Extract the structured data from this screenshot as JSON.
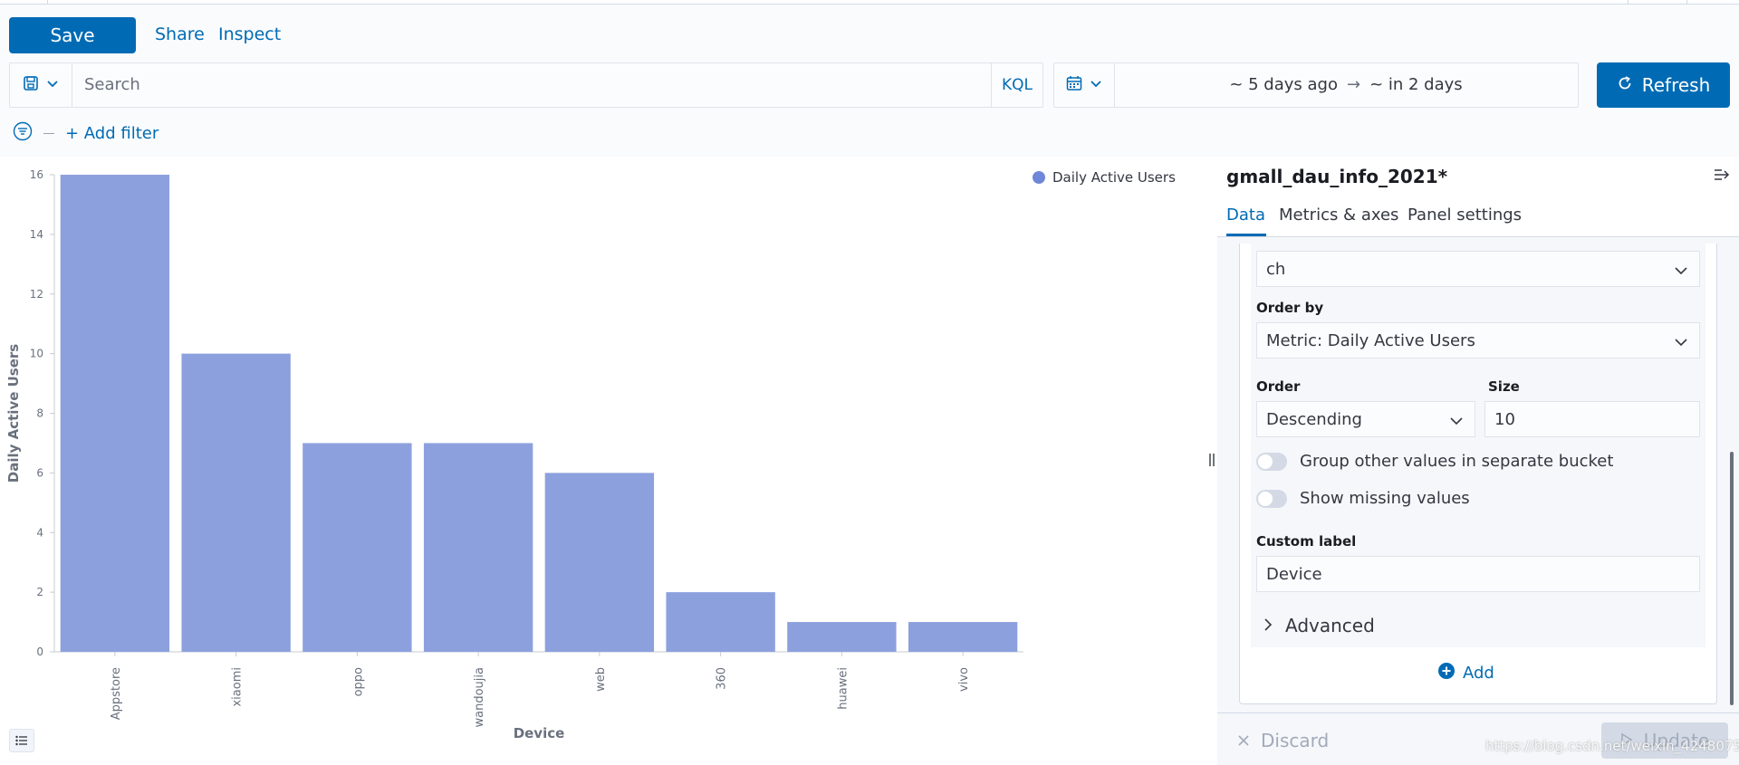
{
  "toolbar": {
    "save_label": "Save",
    "share_label": "Share",
    "inspect_label": "Inspect"
  },
  "query": {
    "search_placeholder": "Search",
    "language": "KQL"
  },
  "time": {
    "start": "~ 5 days ago",
    "arrow": "→",
    "end": "~ in 2 days"
  },
  "refresh_label": "Refresh",
  "filters": {
    "add_label": "+ Add filter"
  },
  "chart_data": {
    "type": "bar",
    "categories": [
      "Appstore",
      "xiaomi",
      "oppo",
      "wandoujia",
      "web",
      "360",
      "huawei",
      "vivo"
    ],
    "series": [
      {
        "name": "Daily Active Users",
        "values": [
          16,
          10,
          7,
          7,
          6,
          2,
          1,
          1
        ],
        "color": "#8da0de"
      }
    ],
    "xlabel": "Device",
    "ylabel": "Daily Active Users",
    "ylim": [
      0,
      16
    ],
    "yticks": [
      0,
      2,
      4,
      6,
      8,
      10,
      12,
      14,
      16
    ],
    "legend_position": "top-right",
    "grid": false
  },
  "panel": {
    "title": "gmall_dau_info_2021*",
    "tabs": [
      "Data",
      "Metrics & axes",
      "Panel settings"
    ],
    "active_tab": "Data",
    "field_value": "ch",
    "order_by_label": "Order by",
    "order_by_value": "Metric: Daily Active Users",
    "order_label": "Order",
    "order_value": "Descending",
    "size_label": "Size",
    "size_value": "10",
    "group_other_label": "Group other values in separate bucket",
    "show_missing_label": "Show missing values",
    "custom_label_label": "Custom label",
    "custom_label_value": "Device",
    "advanced_label": "Advanced",
    "add_label": "Add",
    "discard_label": "Discard",
    "update_label": "Update"
  },
  "watermark": "https://blog.csdn.net/weixin_42480750"
}
